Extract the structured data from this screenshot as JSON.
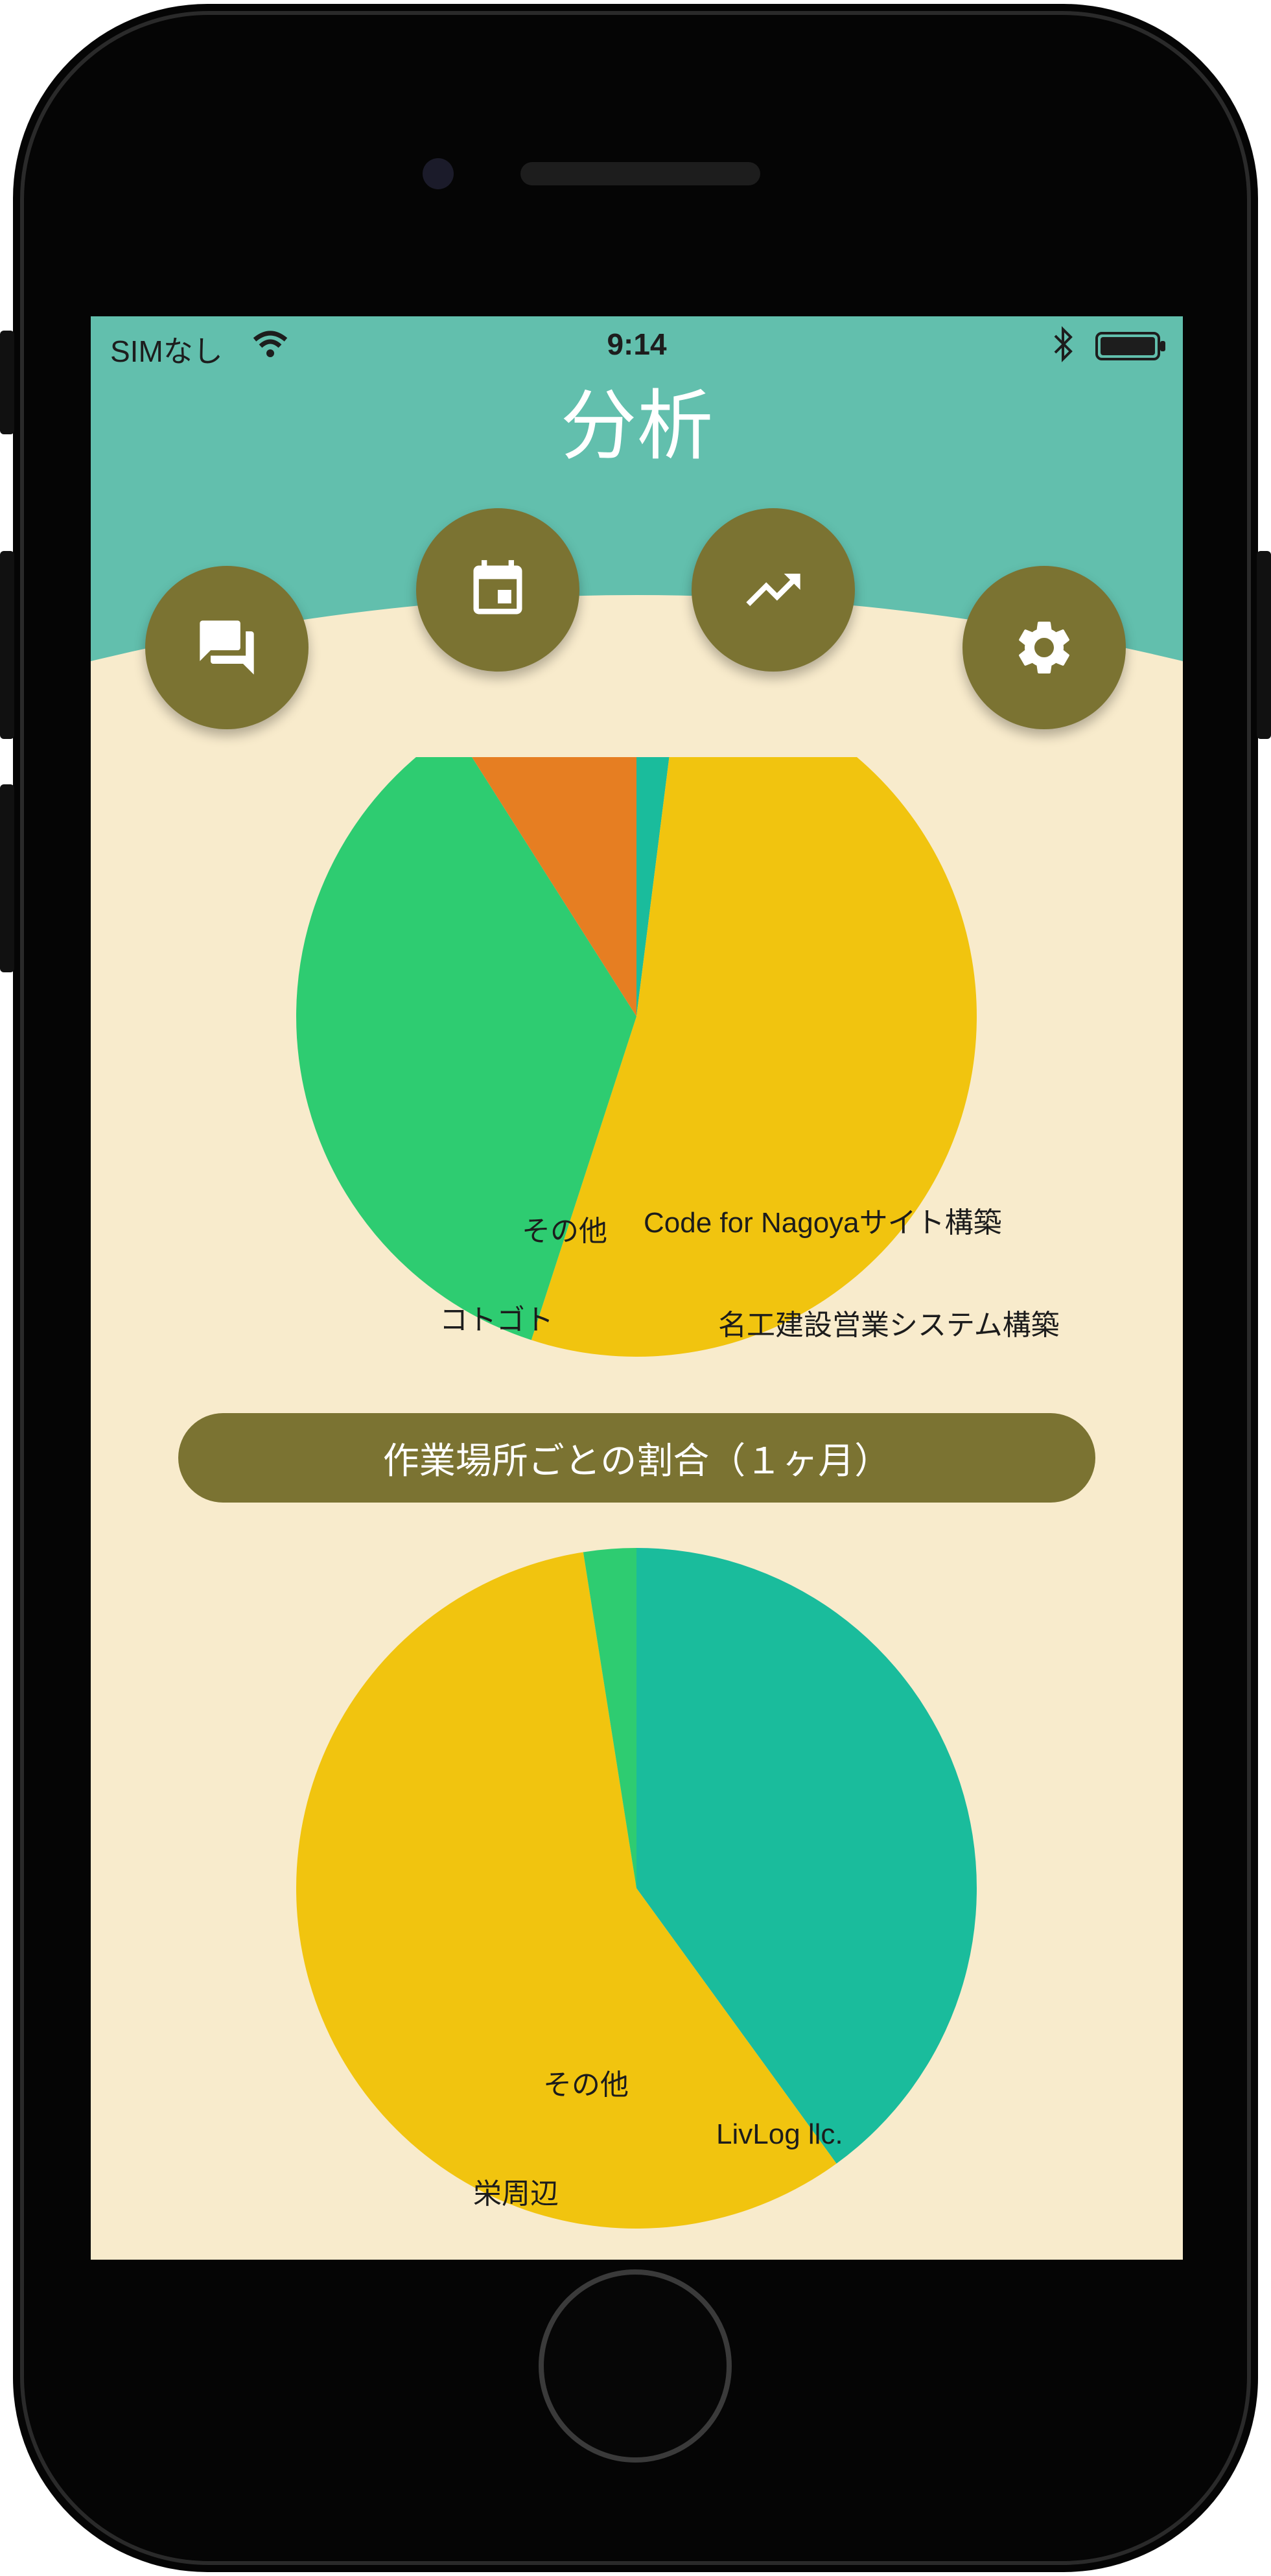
{
  "status_bar": {
    "carrier": "SIMなし",
    "time": "9:14",
    "icons": [
      "wifi-icon",
      "bluetooth-icon",
      "battery-icon"
    ]
  },
  "header": {
    "title": "分析",
    "background_color": "#62bfad",
    "nav_buttons": [
      {
        "icon": "chat-icon"
      },
      {
        "icon": "calendar-icon"
      },
      {
        "icon": "trending-up-icon"
      },
      {
        "icon": "gear-icon"
      }
    ],
    "nav_button_color": "#7b7332"
  },
  "section": {
    "title": "作業場所ごとの割合（１ヶ月）"
  },
  "chart_data": [
    {
      "type": "pie",
      "labels": [
        "Code for Nagoyaサイト構築",
        "名工建設営業システム構築",
        "コトゴト",
        "その他"
      ],
      "values": [
        2,
        53,
        36,
        9
      ],
      "colors": [
        "#1abc9c",
        "#f1c40f",
        "#2ecc71",
        "#e67e22"
      ]
    },
    {
      "type": "pie",
      "labels": [
        "LivLog llc.",
        "栄周辺",
        "その他"
      ],
      "values": [
        40,
        57.5,
        2.5
      ],
      "colors": [
        "#1abc9c",
        "#f1c40f",
        "#2ecc71"
      ]
    }
  ]
}
